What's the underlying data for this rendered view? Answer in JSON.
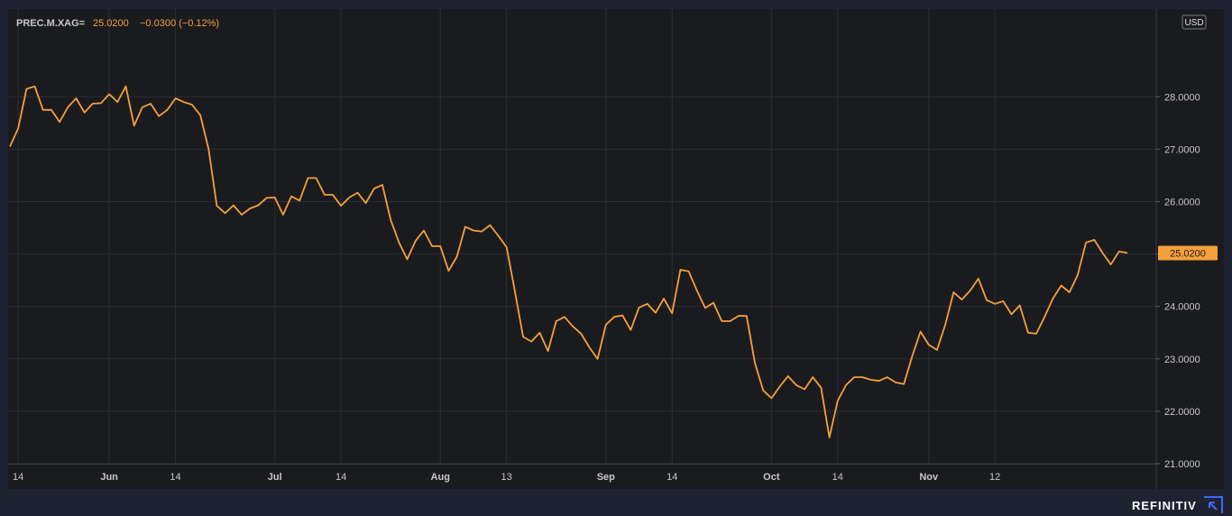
{
  "brand": {
    "name": "REFINITIV",
    "icon": "refinitiv-logo-icon"
  },
  "colors": {
    "background": "#1a1b1f",
    "grid": "#2c2d33",
    "line": "#f5a03c",
    "axis_text": "#c8c8c8",
    "legend_value": "#f5a03c",
    "price_tag_bg": "#f5a03c",
    "price_tag_text": "#1a1b1f"
  },
  "chart_data": {
    "type": "line",
    "legend": {
      "ric": "PREC.M.XAG=",
      "last": "25.0200",
      "change": "−0.0300 (−0.12%)"
    },
    "currency_badge": "USD",
    "last_price_label": "25.0200",
    "ylim": [
      20.9,
      28.7
    ],
    "y_ticks": [
      {
        "value": 28,
        "label": "28.0000"
      },
      {
        "value": 27,
        "label": "27.0000"
      },
      {
        "value": 26,
        "label": "26.0000"
      },
      {
        "value": 25,
        "label": "25.0000"
      },
      {
        "value": 24,
        "label": "24.0000"
      },
      {
        "value": 23,
        "label": "23.0000"
      },
      {
        "value": 22,
        "label": "22.0000"
      },
      {
        "value": 21,
        "label": "21.0000"
      }
    ],
    "x_ticks": [
      {
        "index": 1,
        "label": "14",
        "bold": false
      },
      {
        "index": 12,
        "label": "Jun",
        "bold": true
      },
      {
        "index": 20,
        "label": "14",
        "bold": false
      },
      {
        "index": 32,
        "label": "Jul",
        "bold": true
      },
      {
        "index": 40,
        "label": "14",
        "bold": false
      },
      {
        "index": 52,
        "label": "Aug",
        "bold": true
      },
      {
        "index": 60,
        "label": "13",
        "bold": false
      },
      {
        "index": 72,
        "label": "Sep",
        "bold": true
      },
      {
        "index": 80,
        "label": "14",
        "bold": false
      },
      {
        "index": 92,
        "label": "Oct",
        "bold": true
      },
      {
        "index": 100,
        "label": "14",
        "bold": false
      },
      {
        "index": 111,
        "label": "Nov",
        "bold": true
      },
      {
        "index": 119,
        "label": "12",
        "bold": false
      }
    ],
    "series": [
      {
        "values": [
          27.05,
          27.4,
          28.15,
          28.2,
          27.75,
          27.75,
          27.52,
          27.8,
          27.97,
          27.7,
          27.87,
          27.88,
          28.05,
          27.9,
          28.2,
          27.45,
          27.8,
          27.87,
          27.63,
          27.75,
          27.97,
          27.9,
          27.85,
          27.65,
          27.0,
          25.92,
          25.78,
          25.93,
          25.75,
          25.87,
          25.93,
          26.07,
          26.08,
          25.75,
          26.1,
          26.02,
          26.45,
          26.45,
          26.13,
          26.13,
          25.92,
          26.08,
          26.17,
          25.97,
          26.25,
          26.32,
          25.65,
          25.22,
          24.9,
          25.25,
          25.45,
          25.15,
          25.15,
          24.68,
          24.95,
          25.52,
          25.45,
          25.43,
          25.55,
          25.35,
          25.13,
          24.3,
          23.42,
          23.33,
          23.5,
          23.15,
          23.72,
          23.8,
          23.62,
          23.48,
          23.22,
          23.0,
          23.65,
          23.8,
          23.83,
          23.55,
          23.98,
          24.05,
          23.88,
          24.15,
          23.87,
          24.7,
          24.67,
          24.3,
          23.97,
          24.07,
          23.72,
          23.72,
          23.82,
          23.82,
          22.92,
          22.4,
          22.25,
          22.47,
          22.67,
          22.5,
          22.42,
          22.65,
          22.45,
          21.5,
          22.2,
          22.5,
          22.65,
          22.65,
          22.6,
          22.58,
          22.65,
          22.55,
          22.52,
          23.05,
          23.52,
          23.27,
          23.17,
          23.65,
          24.27,
          24.13,
          24.3,
          24.53,
          24.12,
          24.05,
          24.1,
          23.85,
          24.02,
          23.5,
          23.48,
          23.8,
          24.15,
          24.4,
          24.27,
          24.6,
          25.22,
          25.27,
          25.02,
          24.8,
          25.05,
          25.02
        ]
      }
    ]
  }
}
